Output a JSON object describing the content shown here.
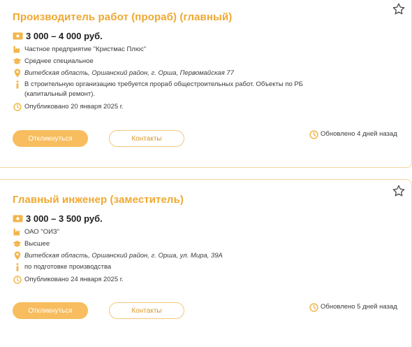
{
  "colors": {
    "accent": "#f0a830",
    "icon": "#f3b54a",
    "button_fill": "#f7bd5e",
    "border": "#f3d7a0"
  },
  "vacancies": [
    {
      "title": "Производитель работ (прораб) (главный)",
      "salary": "3 000 – 4 000 руб.",
      "company": "Частное предприятие \"Кристмас Плюс\"",
      "education": "Среднее специальное",
      "address": "Витебская область, Оршанский район, г. Орша, Первомайская 77",
      "description": "В строительную организацию требуется прораб общестроительных работ. Объекты по РБ (капитальный ремонт).",
      "published": "Опубликовано 20 января 2025 г.",
      "apply_label": "Откликнуться",
      "contacts_label": "Контакты",
      "updated": "Обновлено 4 дней назад"
    },
    {
      "title": "Главный инженер (заместитель)",
      "salary": "3 000 – 3 500 руб.",
      "company": "ОАО \"ОИЗ\"",
      "education": "Высшее",
      "address": "Витебская область, Оршанский район, г. Орша, ул. Мира, 39А",
      "description": "по подготовке производства",
      "published": "Опубликовано 24 января 2025 г.",
      "apply_label": "Откликнуться",
      "contacts_label": "Контакты",
      "updated": "Обновлено 5 дней назад"
    }
  ]
}
